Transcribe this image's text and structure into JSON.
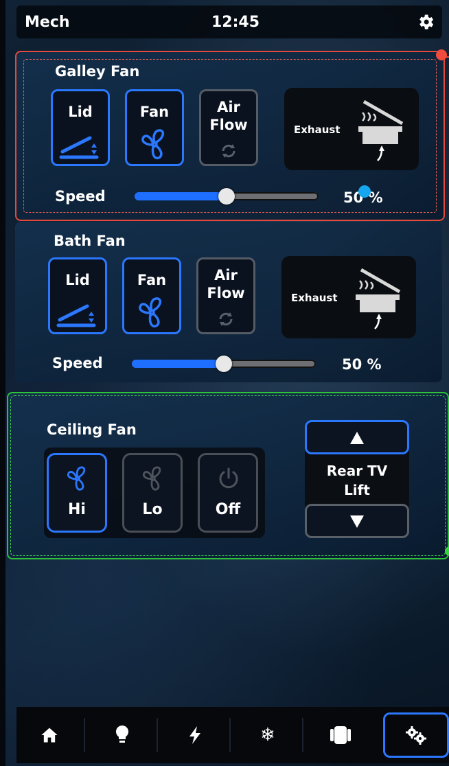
{
  "header": {
    "title": "Mech",
    "clock": "12:45"
  },
  "galley_fan": {
    "title": "Galley Fan",
    "buttons": {
      "lid": "Lid",
      "fan": "Fan",
      "air_line1": "Air",
      "air_line2": "Flow"
    },
    "exhaust_label": "Exhaust",
    "speed_label": "Speed",
    "speed_value": 0.5,
    "speed_text": "50 %"
  },
  "bath_fan": {
    "title": "Bath Fan",
    "buttons": {
      "lid": "Lid",
      "fan": "Fan",
      "air_line1": "Air",
      "air_line2": "Flow"
    },
    "exhaust_label": "Exhaust",
    "speed_label": "Speed",
    "speed_value": 0.5,
    "speed_text": "50 %"
  },
  "ceiling_fan": {
    "title": "Ceiling Fan",
    "hi": "Hi",
    "lo": "Lo",
    "off": "Off",
    "selected": "Hi"
  },
  "rear_tv_lift": {
    "line1": "Rear TV",
    "line2": "Lift"
  },
  "nav": {
    "items": [
      "home-icon",
      "lightbulb-icon",
      "lightning-icon",
      "snowflake-icon",
      "seat-icon",
      "gears-icon"
    ],
    "active": "gears-icon"
  },
  "colors": {
    "accent": "#2b78ff",
    "highlight_red": "#e34a3c",
    "highlight_green": "#2ec23a",
    "marker_blue": "#16a6f0"
  }
}
